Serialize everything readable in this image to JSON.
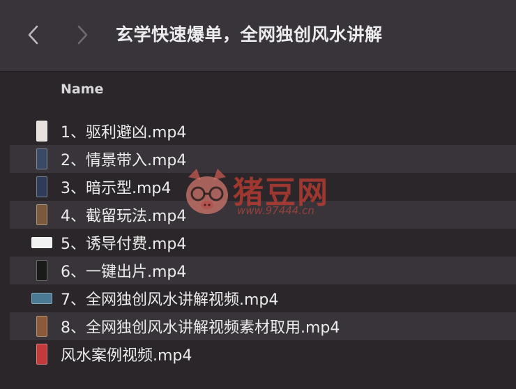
{
  "window": {
    "title": "玄学快速爆单，全网独创风水讲解",
    "back_icon": "chevron-left-icon",
    "forward_icon": "chevron-right-icon"
  },
  "columns": {
    "name": "Name"
  },
  "files": [
    {
      "name": "1、驱利避凶.mp4",
      "thumb": "tall",
      "color": "#e9e2dc"
    },
    {
      "name": "2、情景带入.mp4",
      "thumb": "tall",
      "color": "#3a4a66"
    },
    {
      "name": "3、暗示型.mp4",
      "thumb": "tall",
      "color": "#2e3c5a"
    },
    {
      "name": "4、截留玩法.mp4",
      "thumb": "tall",
      "color": "#7a5a3a"
    },
    {
      "name": "5、诱导付费.mp4",
      "thumb": "wide",
      "color": "#f2f2f2"
    },
    {
      "name": "6、一键出片.mp4",
      "thumb": "tall",
      "color": "#1a1a1a"
    },
    {
      "name": "7、全网独创风水讲解视频.mp4",
      "thumb": "wide",
      "color": "#4a7a94"
    },
    {
      "name": "8、全网独创风水讲解视频素材取用.mp4",
      "thumb": "tall",
      "color": "#8a5a3a"
    },
    {
      "name": "风水案例视频.mp4",
      "thumb": "tall",
      "color": "#c23a3a"
    }
  ],
  "watermark": {
    "brand": "猪豆网",
    "site": "www.97444.cn",
    "logo_icon": "pig-face-icon"
  }
}
